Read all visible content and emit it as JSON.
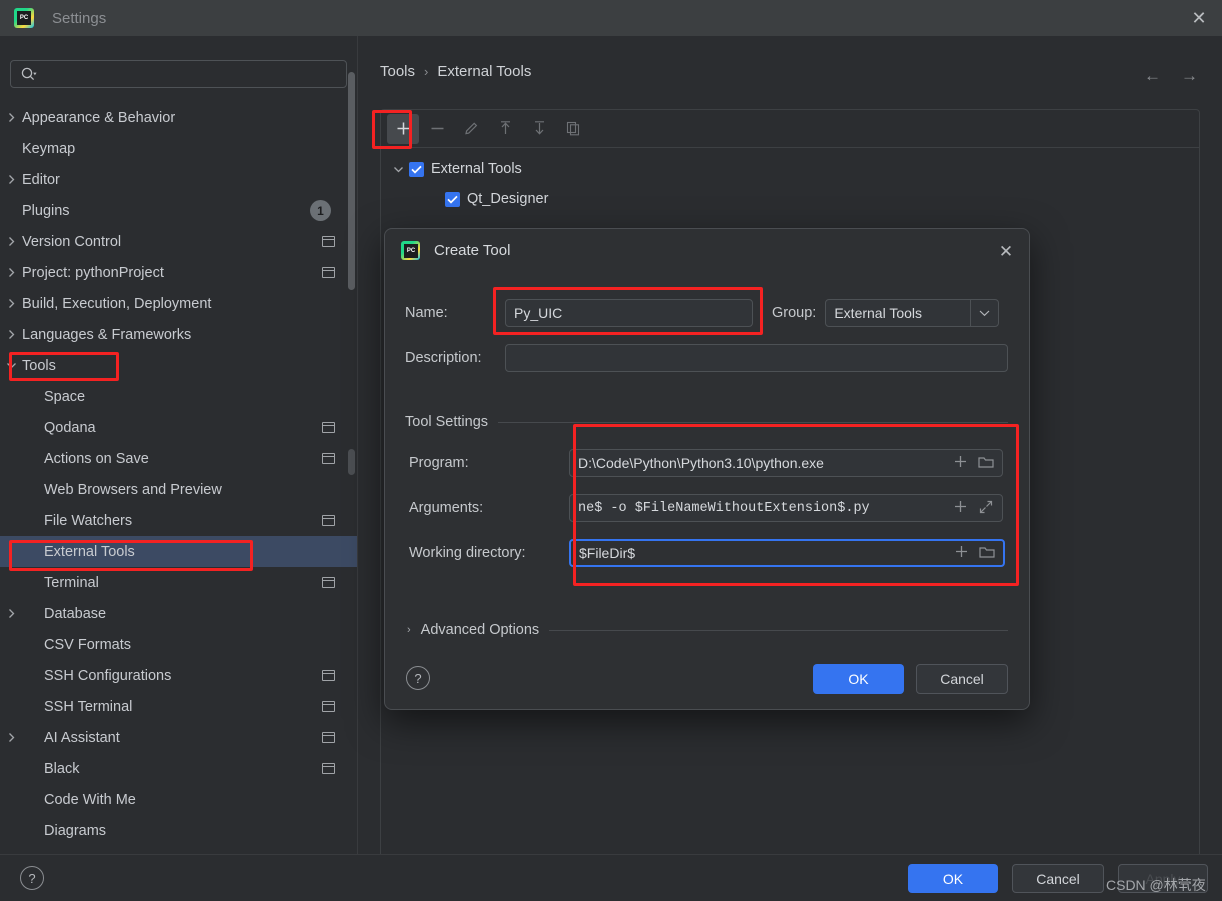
{
  "window": {
    "title": "Settings",
    "logo_text": "PC",
    "close_icon": "✕"
  },
  "search": {
    "value": "",
    "placeholder": ""
  },
  "sidebar": {
    "items": [
      {
        "label": "Appearance & Behavior",
        "depth": 0,
        "expandable": true,
        "expanded": false,
        "badge": "",
        "modified_icon": false,
        "selected": false
      },
      {
        "label": "Keymap",
        "depth": 0,
        "expandable": false,
        "expanded": false,
        "badge": "",
        "modified_icon": false,
        "selected": false
      },
      {
        "label": "Editor",
        "depth": 0,
        "expandable": true,
        "expanded": false,
        "badge": "",
        "modified_icon": false,
        "selected": false
      },
      {
        "label": "Plugins",
        "depth": 0,
        "expandable": false,
        "expanded": false,
        "badge": "1",
        "modified_icon": false,
        "selected": false
      },
      {
        "label": "Version Control",
        "depth": 0,
        "expandable": true,
        "expanded": false,
        "badge": "",
        "modified_icon": true,
        "selected": false
      },
      {
        "label": "Project: pythonProject",
        "depth": 0,
        "expandable": true,
        "expanded": false,
        "badge": "",
        "modified_icon": true,
        "selected": false
      },
      {
        "label": "Build, Execution, Deployment",
        "depth": 0,
        "expandable": true,
        "expanded": false,
        "badge": "",
        "modified_icon": false,
        "selected": false
      },
      {
        "label": "Languages & Frameworks",
        "depth": 0,
        "expandable": true,
        "expanded": false,
        "badge": "",
        "modified_icon": false,
        "selected": false
      },
      {
        "label": "Tools",
        "depth": 0,
        "expandable": true,
        "expanded": true,
        "badge": "",
        "modified_icon": false,
        "selected": false
      },
      {
        "label": "Space",
        "depth": 1,
        "expandable": false,
        "expanded": false,
        "badge": "",
        "modified_icon": false,
        "selected": false
      },
      {
        "label": "Qodana",
        "depth": 1,
        "expandable": false,
        "expanded": false,
        "badge": "",
        "modified_icon": true,
        "selected": false
      },
      {
        "label": "Actions on Save",
        "depth": 1,
        "expandable": false,
        "expanded": false,
        "badge": "",
        "modified_icon": true,
        "selected": false
      },
      {
        "label": "Web Browsers and Preview",
        "depth": 1,
        "expandable": false,
        "expanded": false,
        "badge": "",
        "modified_icon": false,
        "selected": false
      },
      {
        "label": "File Watchers",
        "depth": 1,
        "expandable": false,
        "expanded": false,
        "badge": "",
        "modified_icon": true,
        "selected": false
      },
      {
        "label": "External Tools",
        "depth": 1,
        "expandable": false,
        "expanded": false,
        "badge": "",
        "modified_icon": false,
        "selected": true
      },
      {
        "label": "Terminal",
        "depth": 1,
        "expandable": false,
        "expanded": false,
        "badge": "",
        "modified_icon": true,
        "selected": false
      },
      {
        "label": "Database",
        "depth": 1,
        "expandable": true,
        "expanded": false,
        "badge": "",
        "modified_icon": false,
        "selected": false
      },
      {
        "label": "CSV Formats",
        "depth": 1,
        "expandable": false,
        "expanded": false,
        "badge": "",
        "modified_icon": false,
        "selected": false
      },
      {
        "label": "SSH Configurations",
        "depth": 1,
        "expandable": false,
        "expanded": false,
        "badge": "",
        "modified_icon": true,
        "selected": false
      },
      {
        "label": "SSH Terminal",
        "depth": 1,
        "expandable": false,
        "expanded": false,
        "badge": "",
        "modified_icon": true,
        "selected": false
      },
      {
        "label": "AI Assistant",
        "depth": 1,
        "expandable": true,
        "expanded": false,
        "badge": "",
        "modified_icon": true,
        "selected": false
      },
      {
        "label": "Black",
        "depth": 1,
        "expandable": false,
        "expanded": false,
        "badge": "",
        "modified_icon": true,
        "selected": false
      },
      {
        "label": "Code With Me",
        "depth": 1,
        "expandable": false,
        "expanded": false,
        "badge": "",
        "modified_icon": false,
        "selected": false
      },
      {
        "label": "Diagrams",
        "depth": 1,
        "expandable": false,
        "expanded": false,
        "badge": "",
        "modified_icon": false,
        "selected": false
      }
    ]
  },
  "main": {
    "breadcrumb": {
      "parent": "Tools",
      "separator": "›",
      "current": "External Tools"
    },
    "nav": {
      "back_icon": "←",
      "forward_icon": "→"
    },
    "toolbar": [
      {
        "name": "add",
        "glyph": "+",
        "state": "active"
      },
      {
        "name": "remove",
        "glyph": "−",
        "state": "disabled"
      },
      {
        "name": "edit",
        "glyph": "pencil",
        "state": "disabled"
      },
      {
        "name": "move-up",
        "glyph": "arrow-up",
        "state": "disabled"
      },
      {
        "name": "move-down",
        "glyph": "arrow-down",
        "state": "disabled"
      },
      {
        "name": "copy",
        "glyph": "copy",
        "state": "disabled"
      }
    ],
    "tool_tree": [
      {
        "label": "External Tools",
        "checked": true,
        "depth": 0,
        "expanded": true
      },
      {
        "label": "Qt_Designer",
        "checked": true,
        "depth": 1,
        "expanded": false
      }
    ]
  },
  "dialog": {
    "title": "Create Tool",
    "close_icon": "✕",
    "name_label": "Name:",
    "name_value": "Py_UIC",
    "group_label": "Group:",
    "group_value": "External Tools",
    "description_label": "Description:",
    "description_value": "",
    "tool_settings_title": "Tool Settings",
    "program_label": "Program:",
    "program_value": "D:\\Code\\Python\\Python3.10\\python.exe",
    "arguments_label": "Arguments:",
    "arguments_value": "ne$ -o $FileNameWithoutExtension$.py",
    "working_dir_label": "Working directory:",
    "working_dir_value": "$FileDir$",
    "insert_macro_icon": "+",
    "browse_icon": "folder",
    "expand_icon": "expand",
    "advanced_options_label": "Advanced Options",
    "advanced_chevron": "›",
    "help_icon": "?",
    "ok_label": "OK",
    "cancel_label": "Cancel"
  },
  "footer": {
    "help_icon": "?",
    "ok_label": "OK",
    "cancel_label": "Cancel",
    "apply_label": "Apply"
  },
  "watermark": {
    "text": "CSDN @林茕夜"
  },
  "colors": {
    "accent_blue": "#3574f0",
    "annotation_red": "#f42222",
    "selection_blue": "#3c4a63",
    "window_bg": "#2b2d30",
    "titlebar_bg": "#3c3f41",
    "dialog_bg": "#2e3033"
  }
}
